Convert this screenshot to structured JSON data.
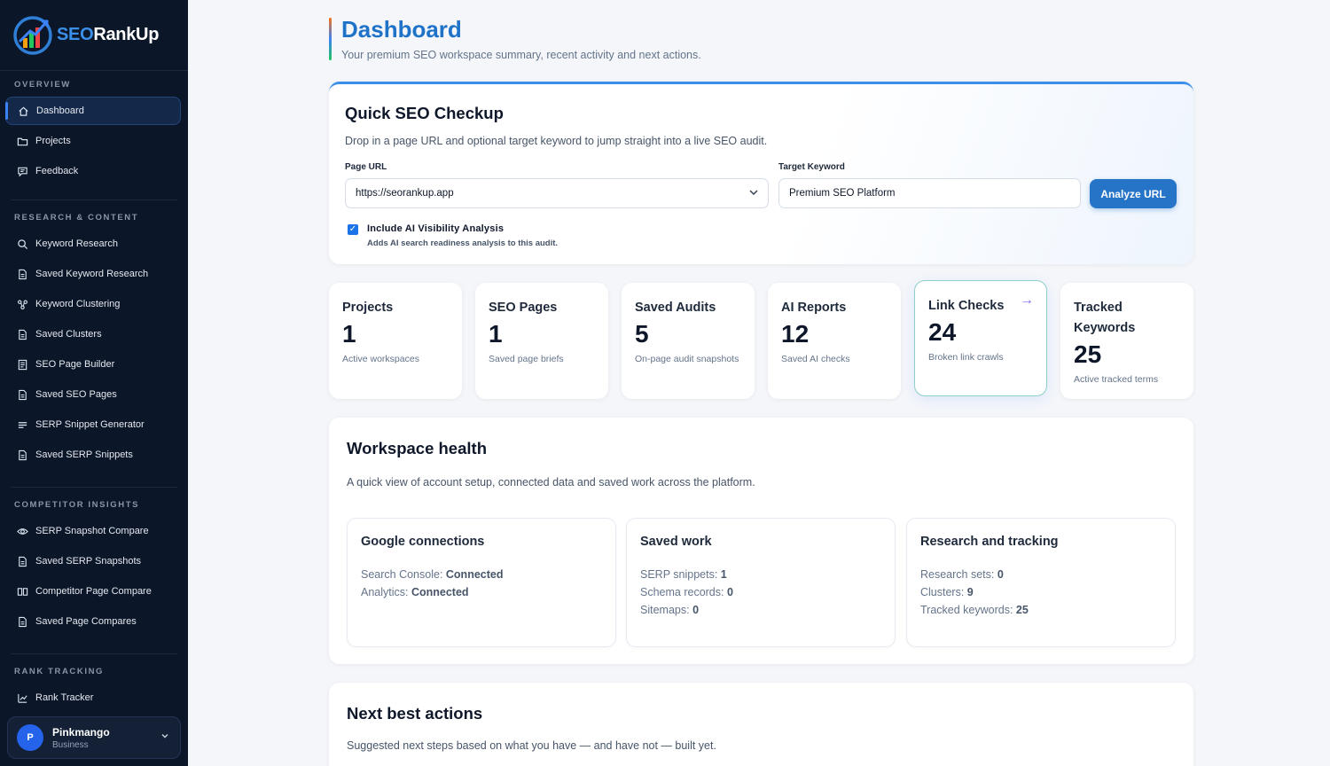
{
  "brand": {
    "part1": "SEO",
    "part2": "RankUp"
  },
  "sidebar": {
    "sections": [
      {
        "label": "OVERVIEW",
        "items": [
          {
            "label": "Dashboard",
            "icon": "home-icon"
          },
          {
            "label": "Projects",
            "icon": "folder-icon"
          },
          {
            "label": "Feedback",
            "icon": "chat-icon"
          }
        ]
      },
      {
        "label": "RESEARCH & CONTENT",
        "items": [
          {
            "label": "Keyword Research",
            "icon": "search-icon"
          },
          {
            "label": "Saved Keyword Research",
            "icon": "document-icon"
          },
          {
            "label": "Keyword Clustering",
            "icon": "cluster-icon"
          },
          {
            "label": "Saved Clusters",
            "icon": "document-icon"
          },
          {
            "label": "SEO Page Builder",
            "icon": "page-builder-icon"
          },
          {
            "label": "Saved SEO Pages",
            "icon": "document-icon"
          },
          {
            "label": "SERP Snippet Generator",
            "icon": "lines-icon"
          },
          {
            "label": "Saved SERP Snippets",
            "icon": "document-icon"
          }
        ]
      },
      {
        "label": "COMPETITOR INSIGHTS",
        "items": [
          {
            "label": "SERP Snapshot Compare",
            "icon": "eye-icon"
          },
          {
            "label": "Saved SERP Snapshots",
            "icon": "document-icon"
          },
          {
            "label": "Competitor Page Compare",
            "icon": "columns-icon"
          },
          {
            "label": "Saved Page Compares",
            "icon": "document-icon"
          }
        ]
      },
      {
        "label": "RANK TRACKING",
        "items": [
          {
            "label": "Rank Tracker",
            "icon": "chart-icon"
          }
        ]
      }
    ]
  },
  "user": {
    "initial": "P",
    "name": "Pinkmango",
    "plan": "Business"
  },
  "header": {
    "title": "Dashboard",
    "subtitle": "Your premium SEO workspace summary, recent activity and next actions."
  },
  "quick_check": {
    "title": "Quick SEO Checkup",
    "description": "Drop in a page URL and optional target keyword to jump straight into a live SEO audit.",
    "url_label": "Page URL",
    "url_value": "https://seorankup.app",
    "keyword_label": "Target Keyword",
    "keyword_value": "Premium SEO Platform",
    "analyze_label": "Analyze URL",
    "ai_option_title": "Include AI Visibility Analysis",
    "ai_option_desc": "Adds AI search readiness analysis to this audit.",
    "ai_option_checked": true
  },
  "stats": [
    {
      "title": "Projects",
      "value": "1",
      "desc": "Active workspaces"
    },
    {
      "title": "SEO Pages",
      "value": "1",
      "desc": "Saved page briefs"
    },
    {
      "title": "Saved Audits",
      "value": "5",
      "desc": "On-page audit snapshots"
    },
    {
      "title": "AI Reports",
      "value": "12",
      "desc": "Saved AI checks"
    },
    {
      "title": "Link Checks",
      "value": "24",
      "desc": "Broken link crawls"
    },
    {
      "title": "Tracked Keywords",
      "value": "25",
      "desc": "Active tracked terms"
    }
  ],
  "health": {
    "title": "Workspace health",
    "description": "A quick view of account setup, connected data and saved work across the platform.",
    "google": {
      "title": "Google connections",
      "sc_label": "Search Console: ",
      "sc_value": "Connected",
      "an_label": "Analytics: ",
      "an_value": "Connected"
    },
    "saved": {
      "title": "Saved work",
      "serp_label": "SERP snippets: ",
      "serp_value": "1",
      "schema_label": "Schema records: ",
      "schema_value": "0",
      "sitemaps_label": "Sitemaps: ",
      "sitemaps_value": "0"
    },
    "research": {
      "title": "Research and tracking",
      "sets_label": "Research sets: ",
      "sets_value": "0",
      "clusters_label": "Clusters: ",
      "clusters_value": "9",
      "tracked_label": "Tracked keywords: ",
      "tracked_value": "25"
    }
  },
  "next_actions": {
    "title": "Next best actions",
    "description": "Suggested next steps based on what you have — and have not — built yet."
  },
  "colors": {
    "accent": "#2574c7",
    "sidebar_bg": "#0b1628",
    "title": "#1e73c9"
  }
}
